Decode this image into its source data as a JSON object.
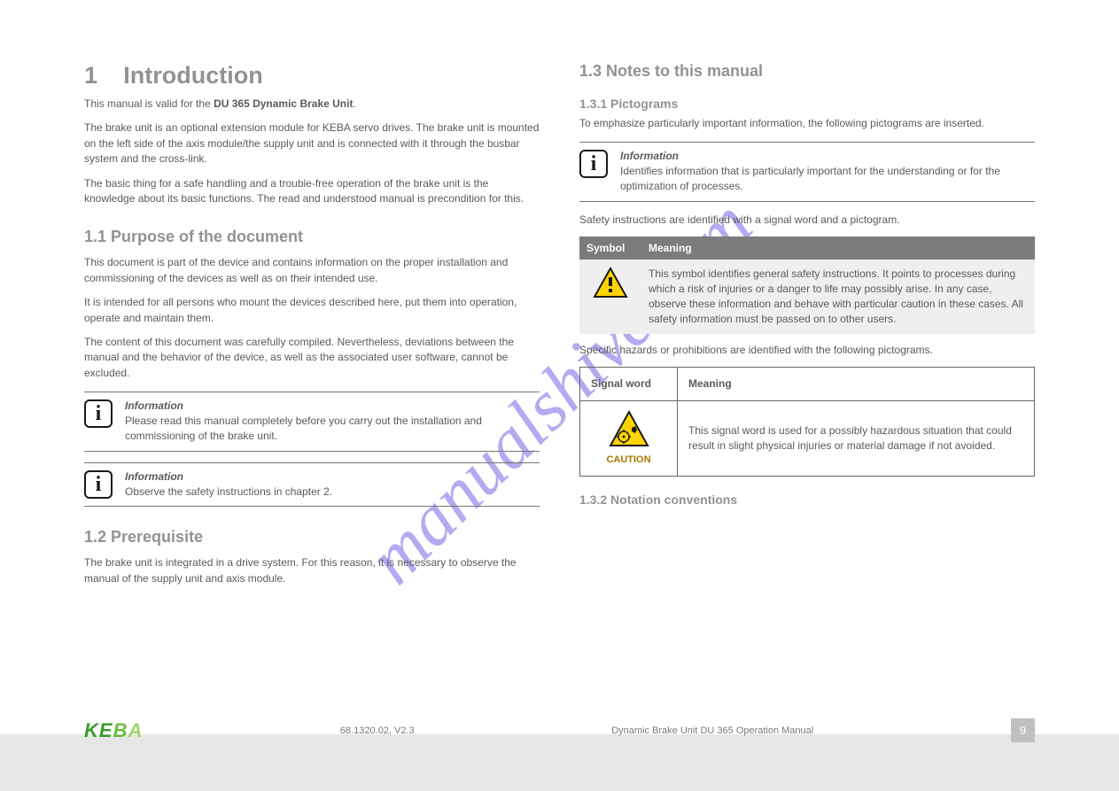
{
  "left": {
    "section_number": "1",
    "section_title": "Introduction",
    "p1": "This manual is valid for the ",
    "p1_bold": "DU 365 Dynamic Brake Unit",
    "p1_tail": ".",
    "p2": "The brake unit is an optional extension module for KEBA servo drives. The brake unit is mounted on the left side of the axis module/the supply unit and is connected with it through the busbar system and the cross-link.",
    "p3": "The basic thing for a safe handling and a trouble-free operation of the brake unit is the knowledge about its basic functions. The read and understood manual is precondition for this.",
    "h2": "1.1 Purpose of the document",
    "p4": "This document is part of the device and contains information on the proper installation and commissioning of the devices as well as on their intended use.",
    "p5": "It is intended for all persons who mount the devices described here, put them into operation, operate and maintain them.",
    "p6": "The content of this document was carefully compiled. Nevertheless, deviations between the manual and the behavior of the device, as well as the associated user software, cannot be excluded.",
    "info1_title": "Information",
    "info1_body": "Please read this manual completely before you carry out the installation and commissioning of the brake unit.",
    "info2_title": "Information",
    "info2_body": "Observe the safety instructions in chapter 2.",
    "h3": "1.2 Prerequisite",
    "p7": "The brake unit is integrated in a drive system. For this reason, it is necessary to observe the manual of the supply unit and axis module."
  },
  "right": {
    "h_notes": "1.3 Notes to this manual",
    "h_pict": "1.3.1 Pictograms",
    "p1": "To emphasize particularly important information, the following pictograms are inserted.",
    "info_title": "Information",
    "info_body": "Identifies information that is particularly important for the understanding or for the optimization of processes.",
    "p2": "Safety instructions are identified with a signal word and a pictogram.",
    "table_h1": "Symbol",
    "table_h2": "Meaning",
    "table_row1": "This symbol identifies general safety instructions. It points to processes during which a risk of injuries or a danger to life may possibly arise. In any case, observe these information and behave with particular caution in these cases. All safety information must be passed on to other users.",
    "p3": "Specific hazards or prohibitions are identified with the following pictograms.",
    "hazard_h1": "Signal word",
    "hazard_h2": "Meaning",
    "caution_word": "CAUTION",
    "caution_body": "This signal word is used for a possibly hazardous situation that could result in slight physical injuries or material damage if not avoided.",
    "h_conv": "1.3.2 Notation conventions"
  },
  "footer": {
    "docid": "68.1320.02, V2.3",
    "title": "Dynamic Brake Unit DU 365 Operation Manual",
    "page": "9"
  }
}
